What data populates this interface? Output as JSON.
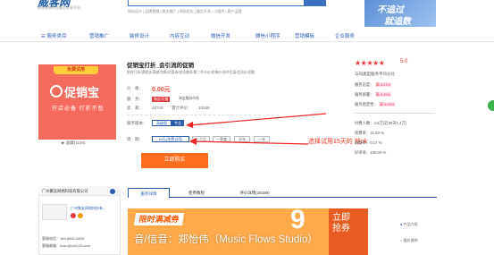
{
  "header": {
    "logo": "威客网",
    "logo_sub": "网络营销外包服务交易平台",
    "hotwords": "网站设计 | 品牌营销 | 软文推广 | 网站优化 | 微信开发 | 小程序 | 客户运营",
    "banner_line1": "不追过",
    "banner_line2": "就追数"
  },
  "nav": [
    "服务类目",
    "营销推广",
    "装修设计",
    "内容互动",
    "微信开发",
    "微信小程序",
    "营销模板",
    "企业服务"
  ],
  "product": {
    "free_tag": "免费试用",
    "brand": "促销宝",
    "brand_sub": "开店必备 打折不愁",
    "favorite": "收藏(1105)",
    "title": "促销宝打折_会引流的促销",
    "desc": "限时打折/满就送/满减/包邮/优惠券/组合套餐/第二件半价/阶梯价/多件优惠/会员价/团购",
    "price_label": "价　格：",
    "price": "0.00元",
    "service_label": "服　务：",
    "service_badge": "淘宝/天猫",
    "service_text": "淘宝服务市场",
    "seller_label": "卖　家：",
    "seller_id": "d3743",
    "sales_label": "累计评价：",
    "sales_count": "18189",
    "version_label": "服务版本：",
    "version_opt": "高级版",
    "version_sel": "专业",
    "period_label": "周　期：",
    "periods": [
      "15天(免费试用)",
      "一个月",
      "一季度",
      "半年",
      "一年"
    ],
    "buy_label": "立即购买",
    "annotation": "选择试用15天的 就ok"
  },
  "rating": {
    "stars": "★★★★★",
    "score": "5.0",
    "heading": "与同类型服务平均分比",
    "rows": [
      {
        "label": "服务态度：",
        "value": "高 9.21%"
      },
      {
        "label": "服务质量：",
        "value": "高 9.35%"
      },
      {
        "label": "服务稳定性：",
        "value": "高 9.54%"
      }
    ],
    "stats": [
      {
        "label": "付费人数：",
        "value": "4.5万(近30天1.4万)"
      },
      {
        "label": "续费率：",
        "value": "31.93 %"
      },
      {
        "label": "退款率：",
        "value": "0.17 %"
      },
      {
        "label": "好评率：",
        "value": "100.00 %"
      }
    ]
  },
  "shop": {
    "name": "广州聚友网络科技有限公司",
    "company": "广州聚友网络科技有...",
    "phone": "客服电话：189-8892-6639",
    "email": "客服邮箱：fuwu@cx6123.com"
  },
  "tabs": [
    "服务详情",
    "使用教程",
    "评价详情(18189)"
  ],
  "promo": {
    "title": "限时满减券",
    "big": "9",
    "go": "立即\n抢券",
    "overlay": "音/信音：郑怡伟（Music Flows Studio）"
  },
  "side_links": [
    "产品介绍",
    "报价说明"
  ]
}
